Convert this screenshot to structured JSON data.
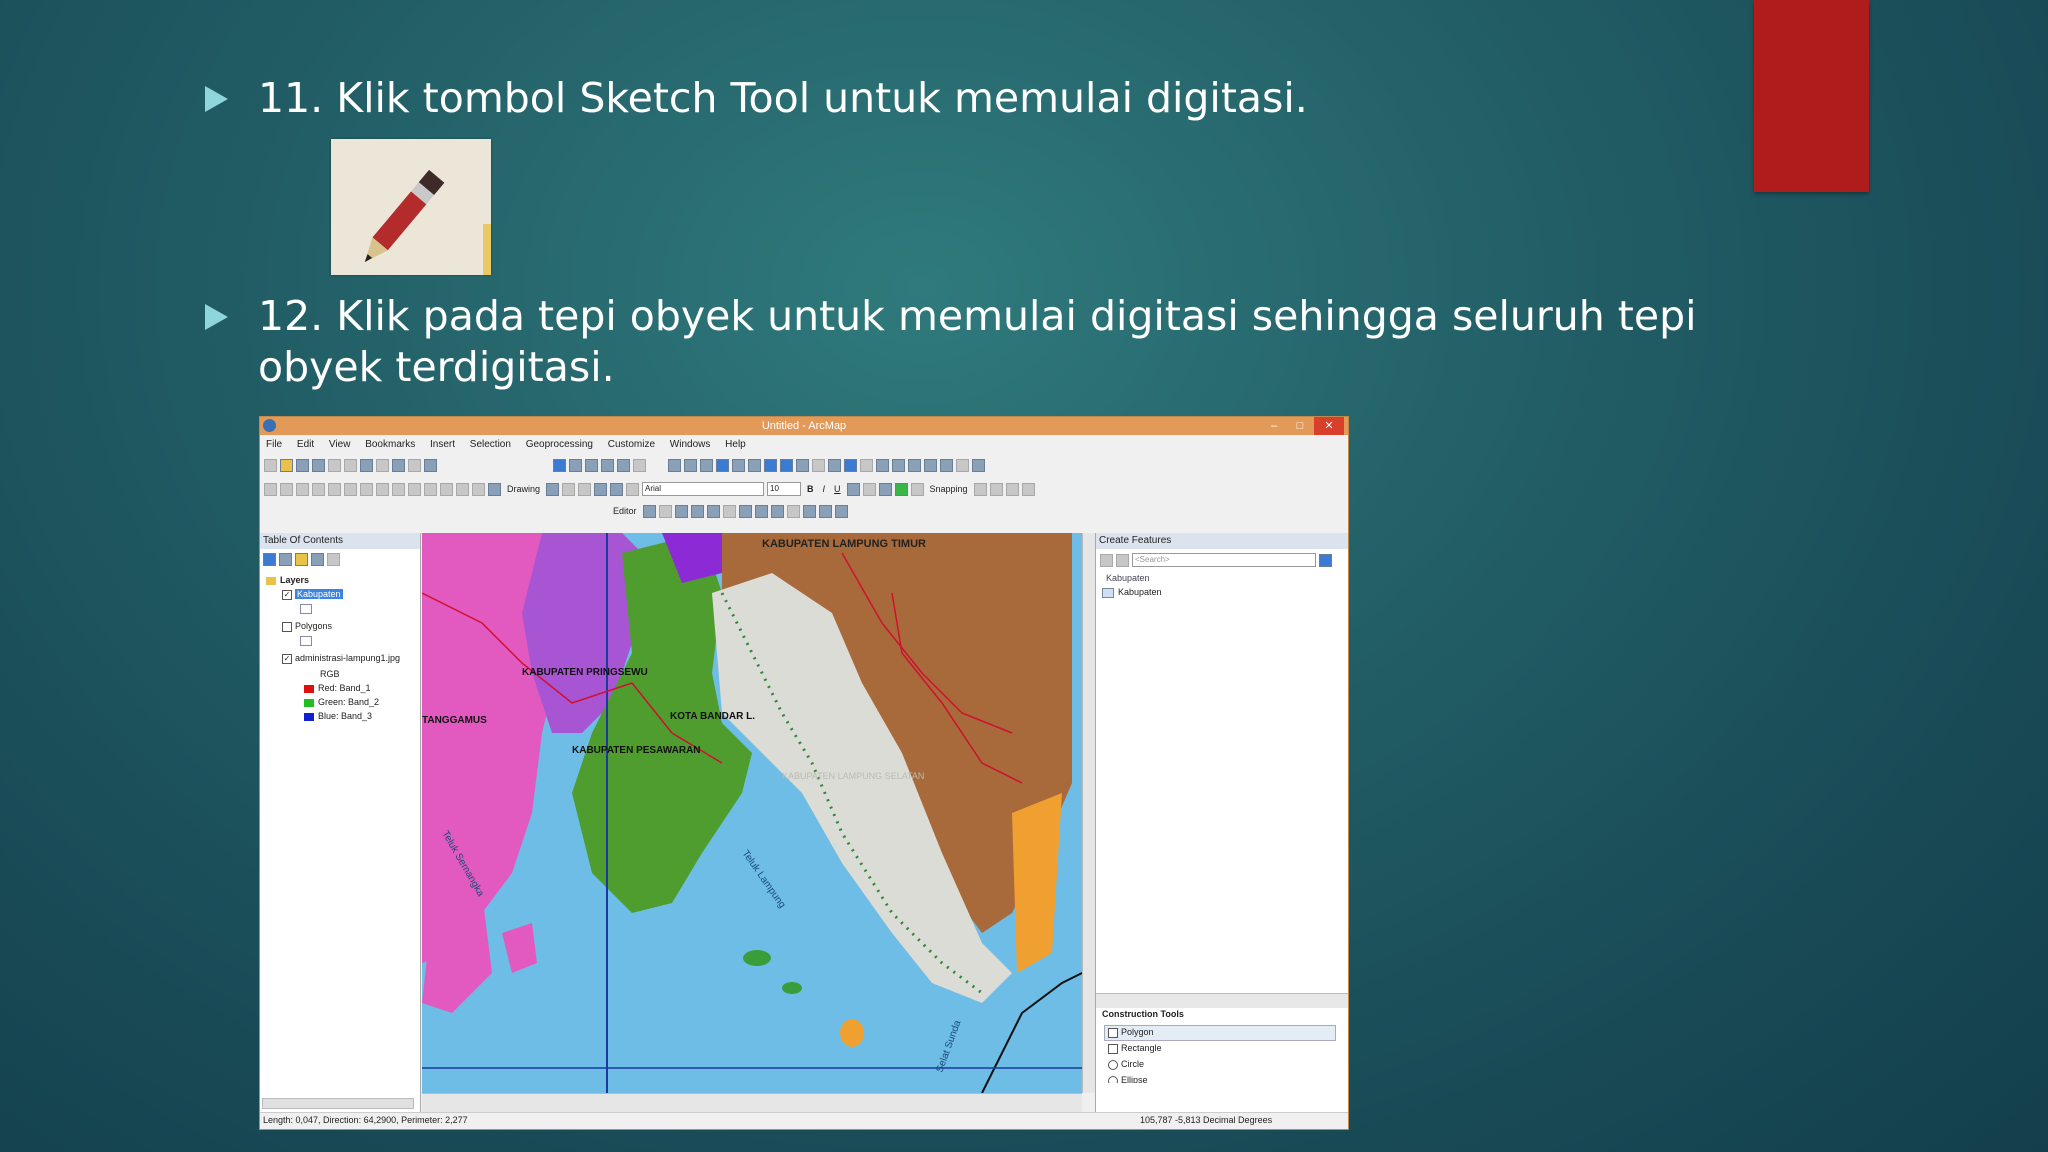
{
  "slide": {
    "step11": "11. Klik tombol Sketch Tool untuk memulai digitasi.",
    "step12_line1": "12. Klik pada tepi obyek untuk memulai digitasi sehingga seluruh tepi",
    "step12_line2": "obyek terdigitasi."
  },
  "arcmap": {
    "title": "Untitled - ArcMap",
    "menu": [
      "File",
      "Edit",
      "View",
      "Bookmarks",
      "Insert",
      "Selection",
      "Geoprocessing",
      "Customize",
      "Windows",
      "Help"
    ],
    "toolbar": {
      "drawing_label": "Drawing",
      "font_name": "Arial",
      "font_size": "10",
      "bold": "B",
      "italic": "I",
      "underline": "U",
      "snapping_label": "Snapping",
      "editor_label": "Editor"
    },
    "toc": {
      "title": "Table Of Contents",
      "layers_label": "Layers",
      "layer1": "Kabupaten",
      "layer2": "Polygons",
      "layer3": "administrasi-lampung1.jpg",
      "rgb_label": "RGB",
      "red_band": "Red:   Band_1",
      "green_band": "Green: Band_2",
      "blue_band": "Blue:  Band_3"
    },
    "map_labels": {
      "lampung_timur": "KABUPATEN LAMPUNG TIMUR",
      "pringsewu": "KABUPATEN PRINGSEWU",
      "tanggamus": "TANGGAMUS",
      "bandar_lampung": "KOTA BANDAR L.",
      "pesawaran": "KABUPATEN PESAWARAN",
      "lampung_selatan": "KABUPATEN LAMPUNG SELATAN",
      "teluk_lampung": "Teluk Lampung",
      "teluk_semangka": "Teluk Semangka",
      "selat_sunda": "Selat Sunda"
    },
    "create_features": {
      "title": "Create Features",
      "search_placeholder": "<Search>",
      "template_group": "Kabupaten",
      "template_item": "Kabupaten",
      "construction_title": "Construction Tools",
      "tools": [
        "Polygon",
        "Rectangle",
        "Circle",
        "Ellipse"
      ]
    },
    "status": {
      "left": "Length: 0,047, Direction: 64,2900, Perimeter: 2,277",
      "right": "105,787  -5,813 Decimal Degrees"
    }
  },
  "colors": {
    "accent_red": "#b01c1c",
    "bullet_arrow": "#8fd5dc",
    "titlebar": "#e39a59",
    "selected_layer": "#3b84e0"
  }
}
